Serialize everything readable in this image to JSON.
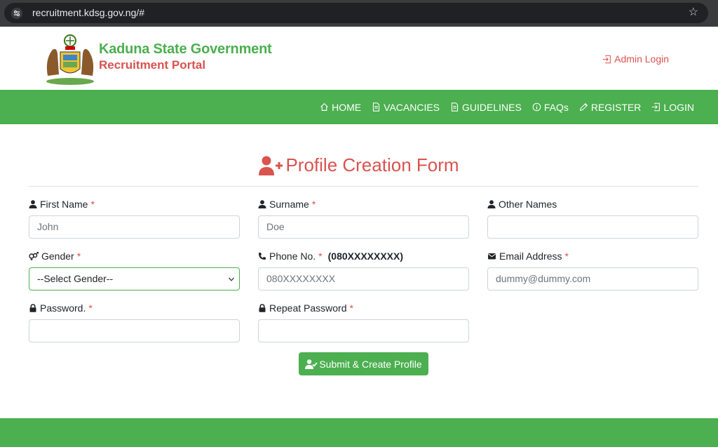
{
  "browser": {
    "url": "recruitment.kdsg.gov.ng/#"
  },
  "header": {
    "title": "Kaduna State Government",
    "subtitle": "Recruitment Portal",
    "admin_login": "Admin Login"
  },
  "nav": {
    "items": [
      {
        "label": "HOME",
        "icon": "home-icon"
      },
      {
        "label": "VACANCIES",
        "icon": "document-icon"
      },
      {
        "label": "GUIDELINES",
        "icon": "document-icon"
      },
      {
        "label": "FAQs",
        "icon": "info-icon"
      },
      {
        "label": "REGISTER",
        "icon": "pencil-icon"
      },
      {
        "label": "LOGIN",
        "icon": "login-icon"
      }
    ]
  },
  "form": {
    "title": "Profile Creation Form",
    "first_name": {
      "label": "First Name",
      "required": "*",
      "placeholder": "John"
    },
    "surname": {
      "label": "Surname",
      "required": "*",
      "placeholder": "Doe"
    },
    "other_names": {
      "label": "Other Names",
      "placeholder": ""
    },
    "gender": {
      "label": "Gender",
      "required": "*",
      "selected": "--Select Gender--"
    },
    "phone": {
      "label": "Phone No.",
      "required": "*",
      "format": "(080XXXXXXXX)",
      "placeholder": "080XXXXXXXX"
    },
    "email": {
      "label": "Email Address",
      "required": "*",
      "placeholder": "dummy@dummy.com"
    },
    "password": {
      "label": "Password.",
      "required": "*",
      "placeholder": ""
    },
    "repeat_password": {
      "label": "Repeat Password",
      "required": "*",
      "placeholder": ""
    },
    "submit": "Submit & Create Profile"
  },
  "colors": {
    "brand_green": "#4caf50",
    "brand_red": "#d9534f"
  }
}
